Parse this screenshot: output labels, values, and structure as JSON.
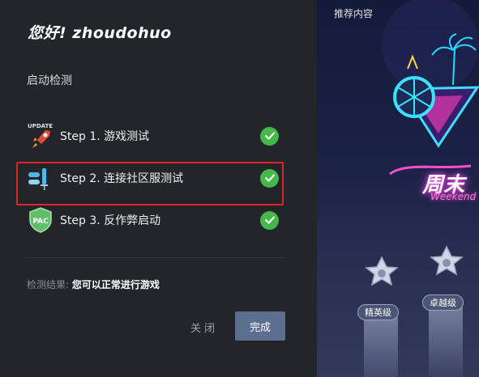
{
  "dialog": {
    "greeting": "您好! zhoudohuo",
    "section_title": "启动检测",
    "steps": [
      {
        "label": "Step 1. 游戏测试",
        "icon": "update-rocket-icon",
        "status": "passed",
        "badge_text": "UPDATE"
      },
      {
        "label": "Step 2. 连接社区服测试",
        "icon": "network-connection-icon",
        "status": "passed"
      },
      {
        "label": "Step 3. 反作弊启动",
        "icon": "pac-shield-icon",
        "status": "passed",
        "badge_text": "PAC"
      }
    ],
    "result_label": "检测结果:",
    "result_value": "您可以正常进行游戏",
    "close_label": "关闭",
    "done_label": "完成"
  },
  "promo": {
    "title": "推荐内容",
    "banner_title": "周末",
    "banner_subtitle": "Weekend",
    "tiers": [
      "精英级",
      "卓越级"
    ]
  },
  "colors": {
    "panel_bg": "#22252a",
    "check_green": "#46b84a",
    "highlight_red": "#e02424",
    "done_button": "#5c6f90"
  }
}
